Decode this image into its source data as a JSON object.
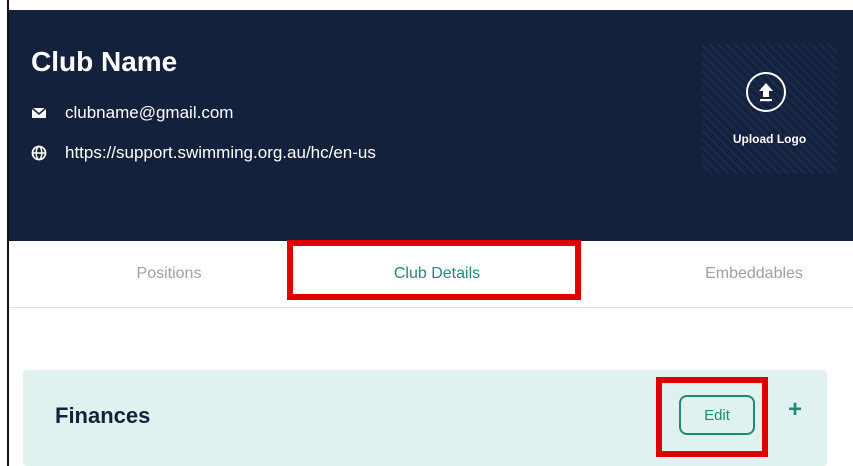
{
  "club": {
    "name": "Club Name",
    "email": "clubname@gmail.com",
    "website": "https://support.swimming.org.au/hc/en-us",
    "upload_logo_label": "Upload Logo"
  },
  "tabs": [
    {
      "label": "Positions",
      "active": false
    },
    {
      "label": "Club Details",
      "active": true
    },
    {
      "label": "Embeddables",
      "active": false
    }
  ],
  "finances": {
    "title": "Finances",
    "edit_label": "Edit",
    "add_label": "+"
  },
  "colors": {
    "header_bg": "#13213d",
    "accent": "#1f8a7a",
    "section_bg": "#dff2ef",
    "highlight": "#e00000"
  }
}
